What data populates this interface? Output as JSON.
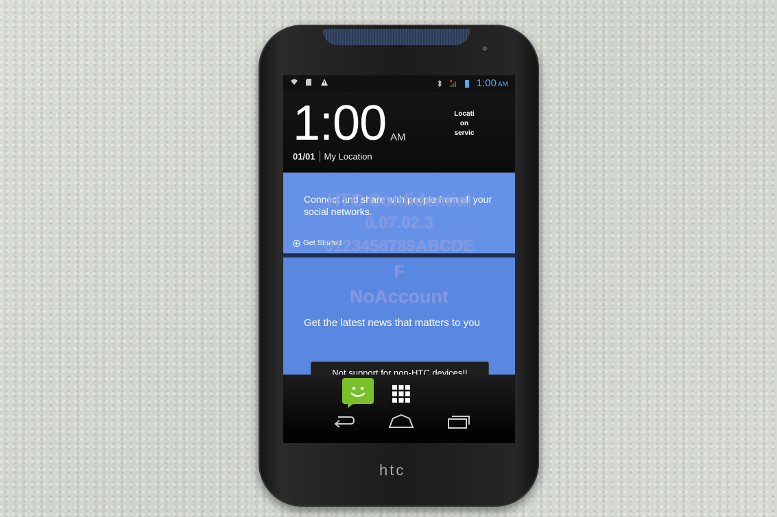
{
  "device": {
    "brand_logo": "htc"
  },
  "status_bar": {
    "time": "1:00",
    "ampm": "AM",
    "icons": [
      "wifi-icon",
      "sd-card-icon",
      "warning-icon",
      "bluetooth-icon",
      "no-signal-icon",
      "battery-icon"
    ],
    "accent_color": "#4aa8ff"
  },
  "clock_widget": {
    "time": "1:00",
    "ampm": "AM",
    "date": "01/01",
    "location": "My Location",
    "weather_text_line1": "Locati",
    "weather_text_line2": "on",
    "weather_text_line3": "servic"
  },
  "feed": {
    "card1_text": "Connect and share with people from all your social networks.",
    "card1_action": "Get Started",
    "card2_text": "Get the latest news that matters to you",
    "card_color": "#6592e6"
  },
  "watermark": {
    "line1": "HTC Confidential",
    "line2": "0.07.02.3",
    "line3": "0123456789ABCDE",
    "line4": "F",
    "line5": "NoAccount"
  },
  "toast": {
    "message": "Not support for non-HTC devices!!"
  },
  "dock": {
    "items": [
      "messages-icon",
      "all-apps-icon"
    ],
    "messages_color": "#79c02a"
  },
  "nav_bar": {
    "buttons": [
      "back-icon",
      "home-icon",
      "recent-apps-icon"
    ]
  }
}
